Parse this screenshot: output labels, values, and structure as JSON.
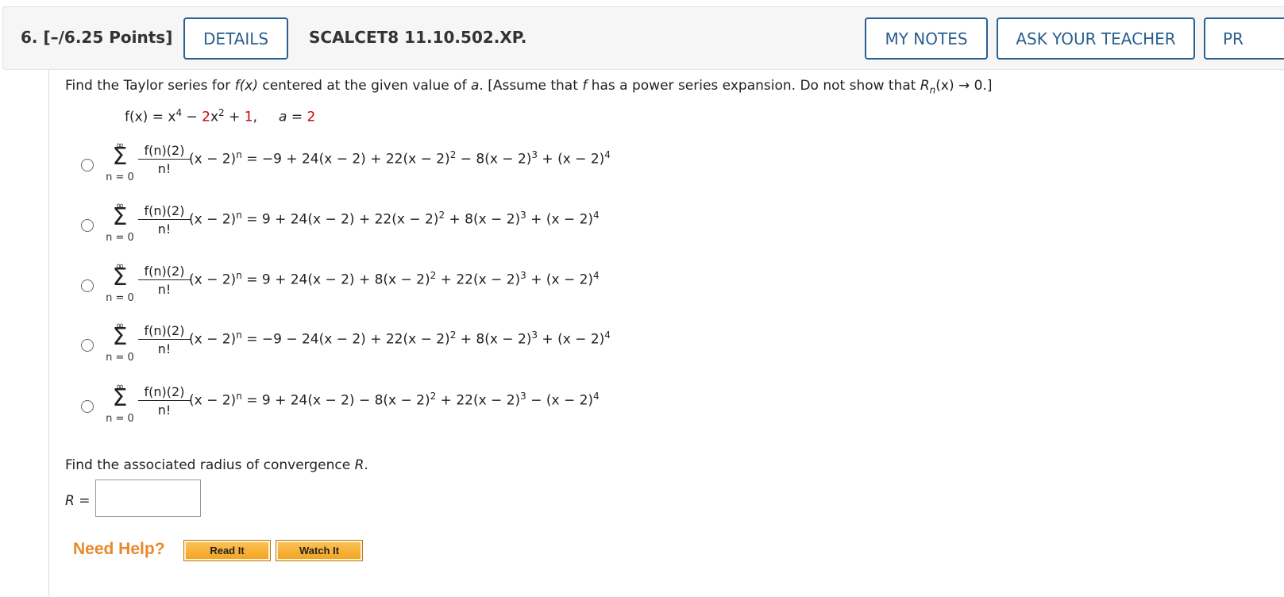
{
  "header": {
    "question_number": "6. [–/6.25 Points]",
    "details_label": "DETAILS",
    "code": "SCALCET8 11.10.502.XP.",
    "my_notes_label": "MY NOTES",
    "ask_teacher_label": "ASK YOUR TEACHER",
    "practice_label": "PR"
  },
  "prompt": {
    "p1": "Find the Taylor series for ",
    "fx": "f(x)",
    "p2": " centered at the given value of ",
    "a": "a",
    "p3": ". [Assume that ",
    "f": "f",
    "p4": " has a power series expansion. Do not show that ",
    "R": "R",
    "n": "n",
    "p5": "(x) → 0.]"
  },
  "function": {
    "lhs": "f(x) = x",
    "exp4": "4",
    "minus": " − ",
    "coef2": "2",
    "x": "x",
    "exp2": "2",
    "plus": " + ",
    "const": "1",
    "comma": ",",
    "a_label": "a = ",
    "a_value": "2"
  },
  "series": {
    "sup_top": "∞",
    "sigma": "Σ",
    "sub": "n = 0",
    "numerator": "f(n)(2)",
    "denominator": "n!",
    "prefix": "(x − 2)",
    "prefix_exp": "n"
  },
  "options": [
    {
      "body": " = −9 + 24(x − 2) + 22(x − 2)",
      "e1": "2",
      "mid": " − 8(x − 2)",
      "e2": "3",
      "end": " + (x − 2)",
      "e3": "4"
    },
    {
      "body": " = 9 + 24(x − 2) + 22(x − 2)",
      "e1": "2",
      "mid": " + 8(x − 2)",
      "e2": "3",
      "end": " + (x − 2)",
      "e3": "4"
    },
    {
      "body": " = 9 + 24(x − 2) + 8(x − 2)",
      "e1": "2",
      "mid": " + 22(x − 2)",
      "e2": "3",
      "end": " + (x − 2)",
      "e3": "4"
    },
    {
      "body": " = −9 − 24(x − 2) + 22(x − 2)",
      "e1": "2",
      "mid": " + 8(x − 2)",
      "e2": "3",
      "end": " + (x − 2)",
      "e3": "4"
    },
    {
      "body": " = 9 + 24(x − 2) − 8(x − 2)",
      "e1": "2",
      "mid": " + 22(x − 2)",
      "e2": "3",
      "end": " − (x − 2)",
      "e3": "4"
    }
  ],
  "radius": {
    "question": "Find the associated radius of convergence ",
    "R": "R",
    "period": ".",
    "label": "R",
    "eq": " =",
    "value": ""
  },
  "help": {
    "label": "Need Help?",
    "read_it": "Read It",
    "watch_it": "Watch It"
  },
  "colors": {
    "accent": "#2a5f8f",
    "highlight_red": "#d00000",
    "help_orange": "#e8892b"
  }
}
